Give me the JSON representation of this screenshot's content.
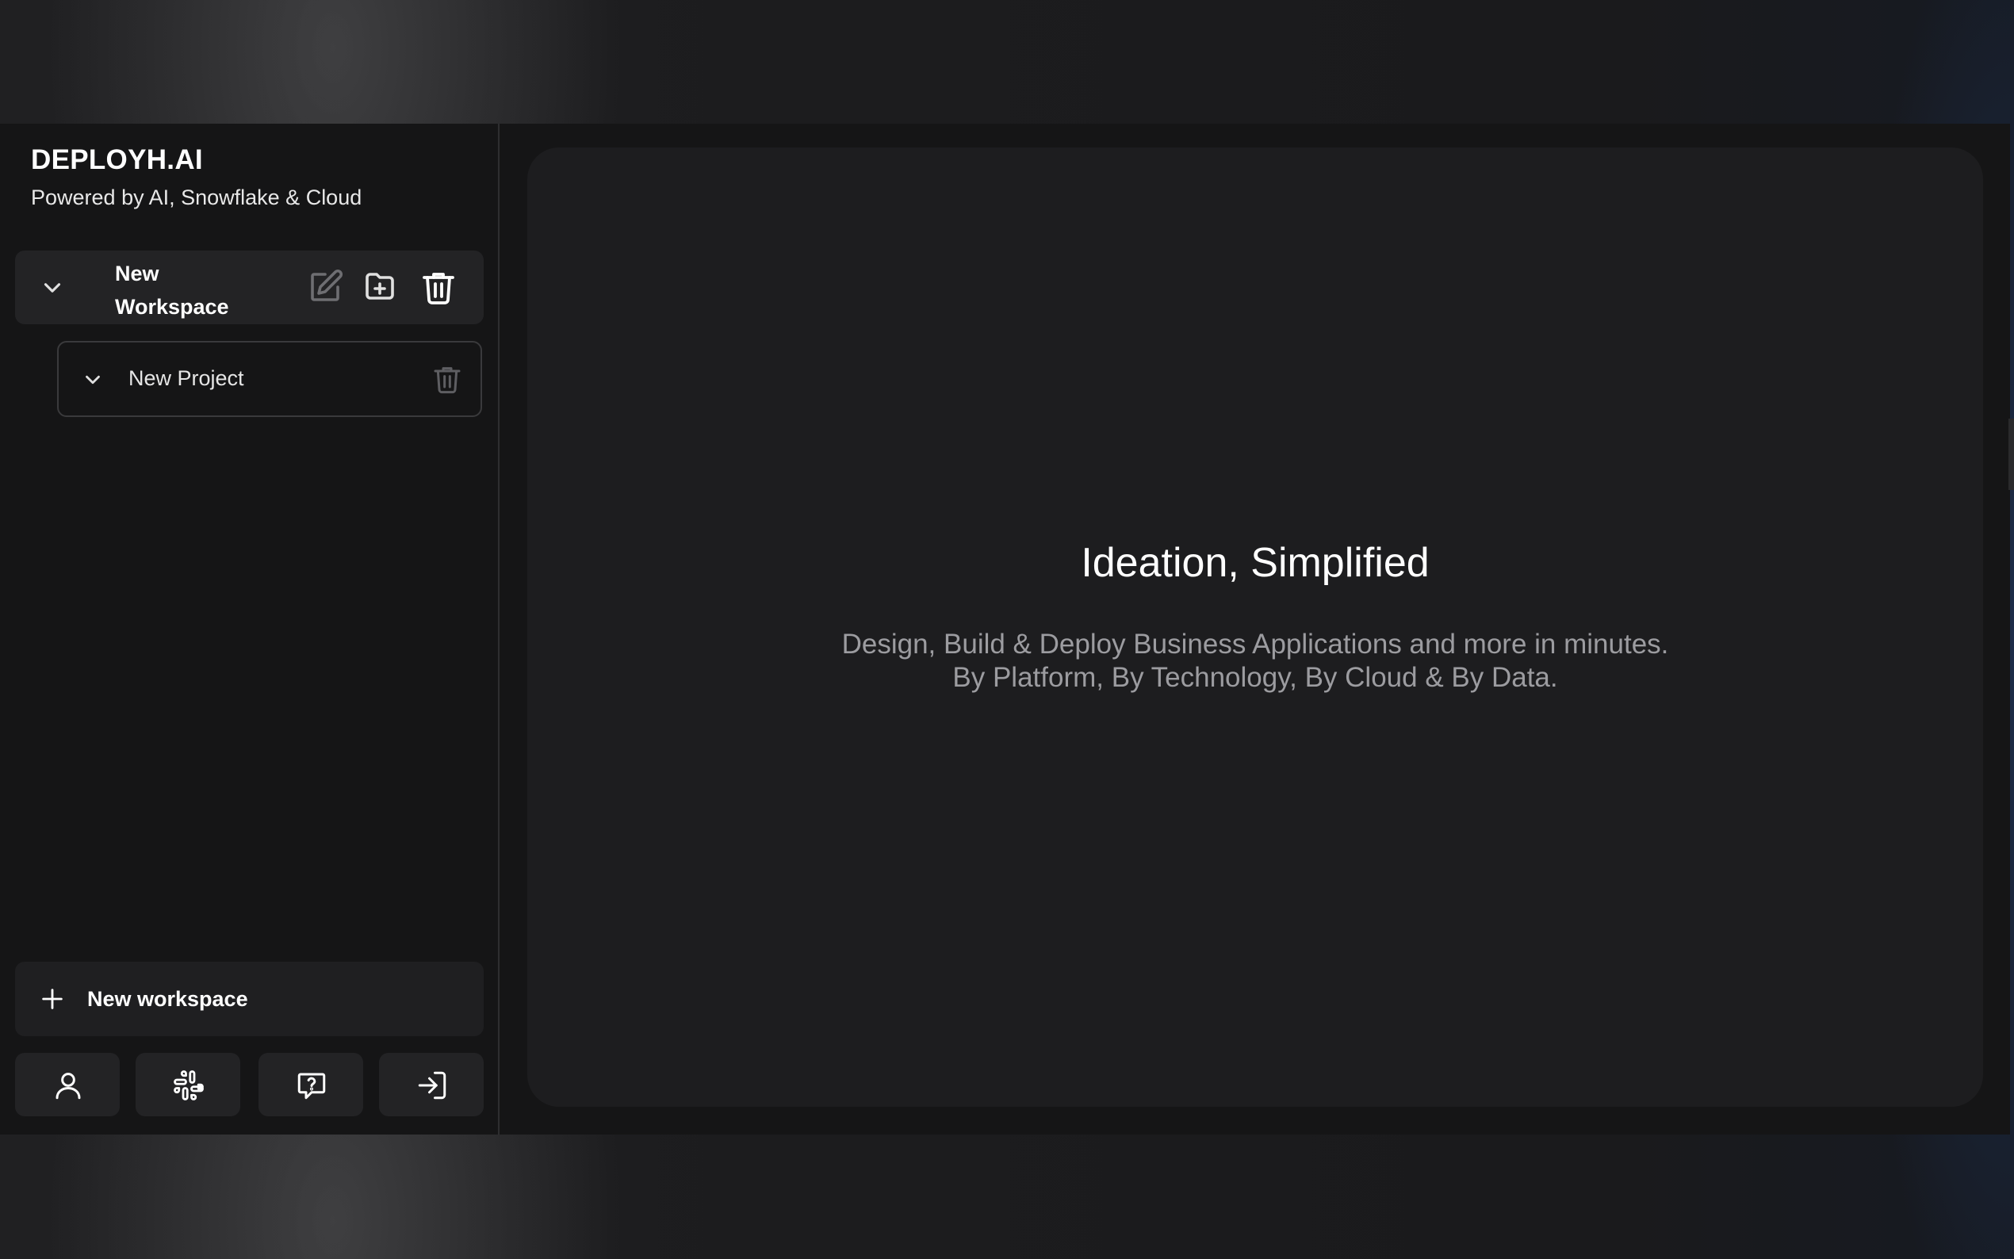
{
  "brand": {
    "title": "DEPLOYH.AI",
    "subtitle": "Powered by AI, Snowflake & Cloud"
  },
  "sidebar": {
    "workspace": {
      "name_line1": "New",
      "name_line2": "Workspace",
      "icons": [
        "chevron-down-icon",
        "edit-icon",
        "folder-plus-icon",
        "trash-icon"
      ]
    },
    "project": {
      "name": "New Project",
      "icons": [
        "chevron-down-icon",
        "trash-icon"
      ]
    },
    "new_workspace_label": "New workspace",
    "footer_icons": [
      "user-icon",
      "slack-icon",
      "help-chat-icon",
      "login-icon"
    ]
  },
  "main": {
    "title": "Ideation, Simplified",
    "subtitle_line1": "Design, Build & Deploy Business Applications and more in minutes.",
    "subtitle_line2": "By Platform, By Technology, By Cloud & By Data."
  },
  "colors": {
    "app_bg": "#151516",
    "panel_bg": "#1d1d1f",
    "row_bg": "#232325",
    "text_primary": "#ffffff",
    "text_muted": "#9c9ca0"
  }
}
